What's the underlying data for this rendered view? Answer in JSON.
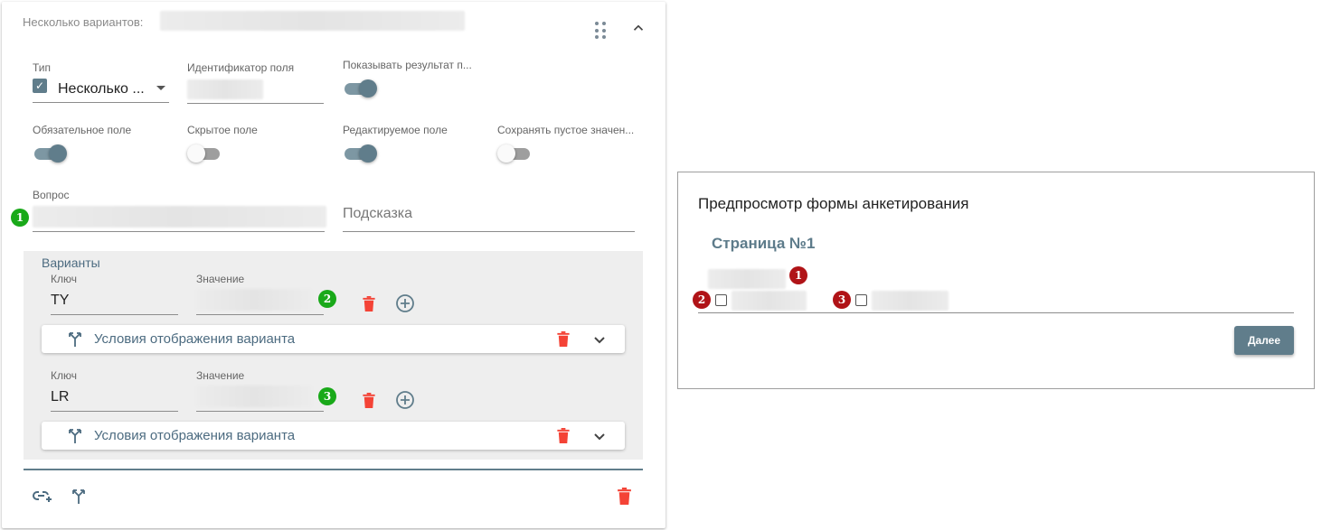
{
  "editor": {
    "header_label": "Несколько вариантов:",
    "type": {
      "label": "Тип",
      "value": "Несколько ..."
    },
    "field_id": {
      "label": "Идентификатор поля"
    },
    "show_result": {
      "label": "Показывать результат п...",
      "on": true
    },
    "required": {
      "label": "Обязательное поле",
      "on": true
    },
    "hidden": {
      "label": "Скрытое поле",
      "on": false
    },
    "editable": {
      "label": "Редактируемое поле",
      "on": true
    },
    "save_empty": {
      "label": "Сохранять пустое значен...",
      "on": false
    },
    "question": {
      "label": "Вопрос",
      "badge": "1"
    },
    "hint": {
      "placeholder": "Подсказка"
    },
    "variants": {
      "title": "Варианты",
      "items": [
        {
          "key_label": "Ключ",
          "key": "TY",
          "value_label": "Значение",
          "badge": "2",
          "condition_label": "Условия отображения варианта"
        },
        {
          "key_label": "Ключ",
          "key": "LR",
          "value_label": "Значение",
          "badge": "3",
          "condition_label": "Условия отображения варианта"
        }
      ]
    }
  },
  "preview": {
    "title": "Предпросмотр формы анкетирования",
    "page": "Страница №1",
    "badges": [
      "1",
      "2",
      "3"
    ],
    "next_button": "Далее"
  },
  "colors": {
    "accent": "#607d8b",
    "badge_green": "#19a919",
    "badge_red": "#b01317",
    "trash_red": "#f44336",
    "variants_bg": "#eeeeee"
  }
}
